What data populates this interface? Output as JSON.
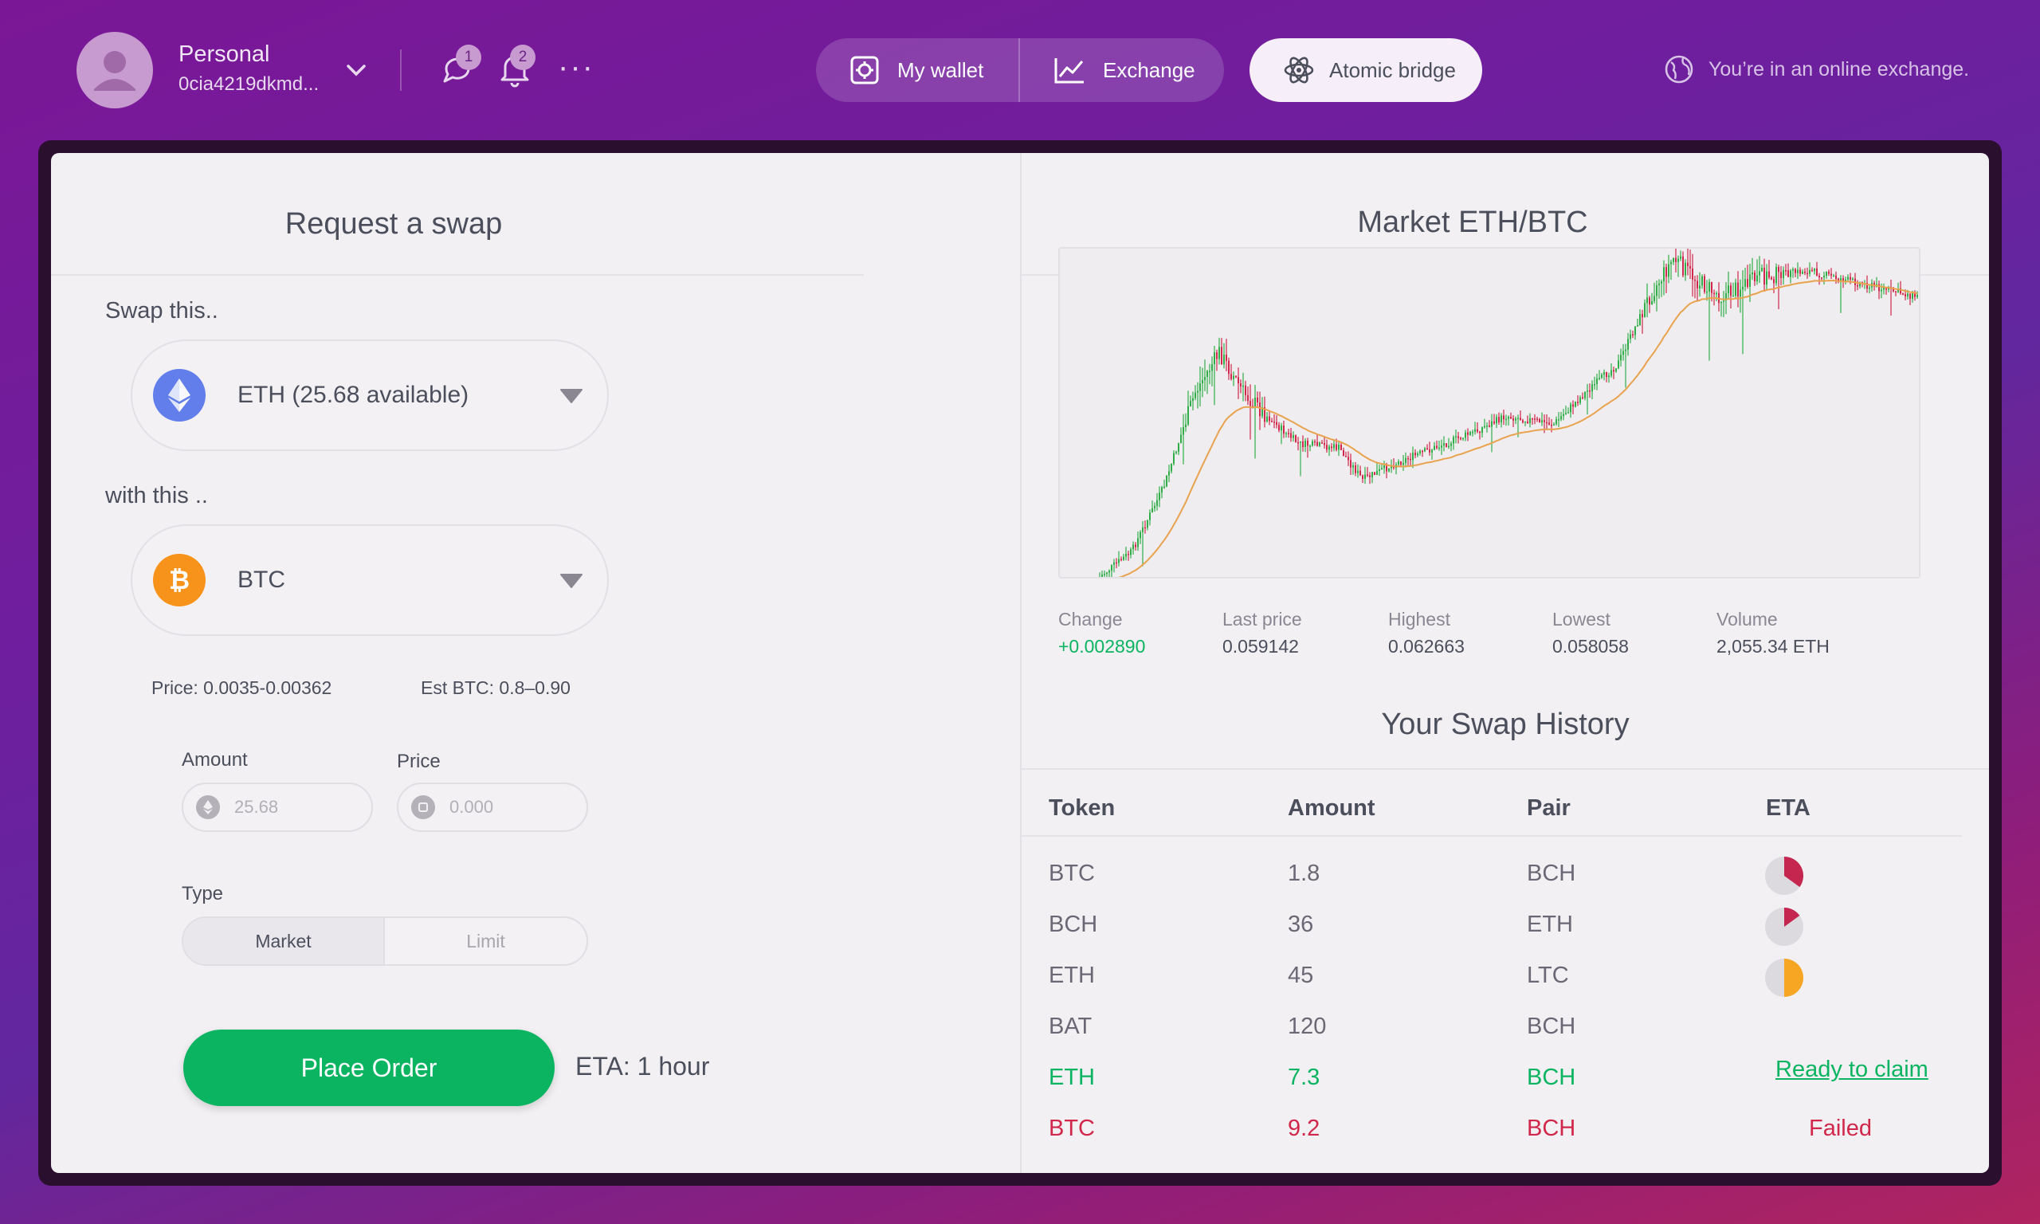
{
  "account": {
    "name": "Personal",
    "id": "0cia4219dkmd...",
    "messages_count": "1",
    "notifications_count": "2"
  },
  "nav": {
    "wallet": "My wallet",
    "exchange": "Exchange",
    "atomic": "Atomic bridge",
    "online_note": "You’re in an online exchange."
  },
  "request": {
    "title": "Request a swap",
    "swap_label": "Swap this..",
    "swap_value": "ETH (25.68 available)",
    "with_label": "with this ..",
    "with_value": "BTC",
    "price_info": "Price: 0.0035-0.00362",
    "est_info": "Est BTC: 0.8–0.90",
    "amount_label": "Amount",
    "amount_placeholder": "25.68",
    "price_label": "Price",
    "price_placeholder": "0.000",
    "type_label": "Type",
    "type_market": "Market",
    "type_limit": "Limit",
    "place_order": "Place Order",
    "eta": "ETA: 1 hour"
  },
  "market": {
    "title": "Market ETH/BTC",
    "stats": [
      {
        "label": "Change",
        "value": "+0.002890"
      },
      {
        "label": "Last price",
        "value": "0.059142"
      },
      {
        "label": "Highest",
        "value": "0.062663"
      },
      {
        "label": "Lowest",
        "value": "0.058058"
      },
      {
        "label": "Volume",
        "value": "2,055.34 ETH"
      }
    ]
  },
  "history": {
    "title": "Your Swap History",
    "headers": [
      "Token",
      "Amount",
      "Pair",
      "ETA"
    ],
    "rows": [
      {
        "token": "BTC",
        "amount": "1.8",
        "pair": "BCH",
        "status": "pie",
        "progress": 0.35,
        "color": "#c4264f"
      },
      {
        "token": "BCH",
        "amount": "36",
        "pair": "ETH",
        "status": "pie",
        "progress": 0.15,
        "color": "#c4264f"
      },
      {
        "token": "ETH",
        "amount": "45",
        "pair": "LTC",
        "status": "pie",
        "progress": 0.5,
        "color": "#f6a623"
      },
      {
        "token": "BAT",
        "amount": "120",
        "pair": "BCH",
        "status": "none"
      },
      {
        "token": "ETH",
        "amount": "7.3",
        "pair": "BCH",
        "status": "claim",
        "label": "Ready to claim"
      },
      {
        "token": "BTC",
        "amount": "9.2",
        "pair": "BCH",
        "status": "failed",
        "label": "Failed"
      }
    ]
  },
  "colors": {
    "accent_green": "#0bb460",
    "failed_red": "#d0274a",
    "eth_blue": "#627eea",
    "btc_orange": "#f7931a"
  }
}
